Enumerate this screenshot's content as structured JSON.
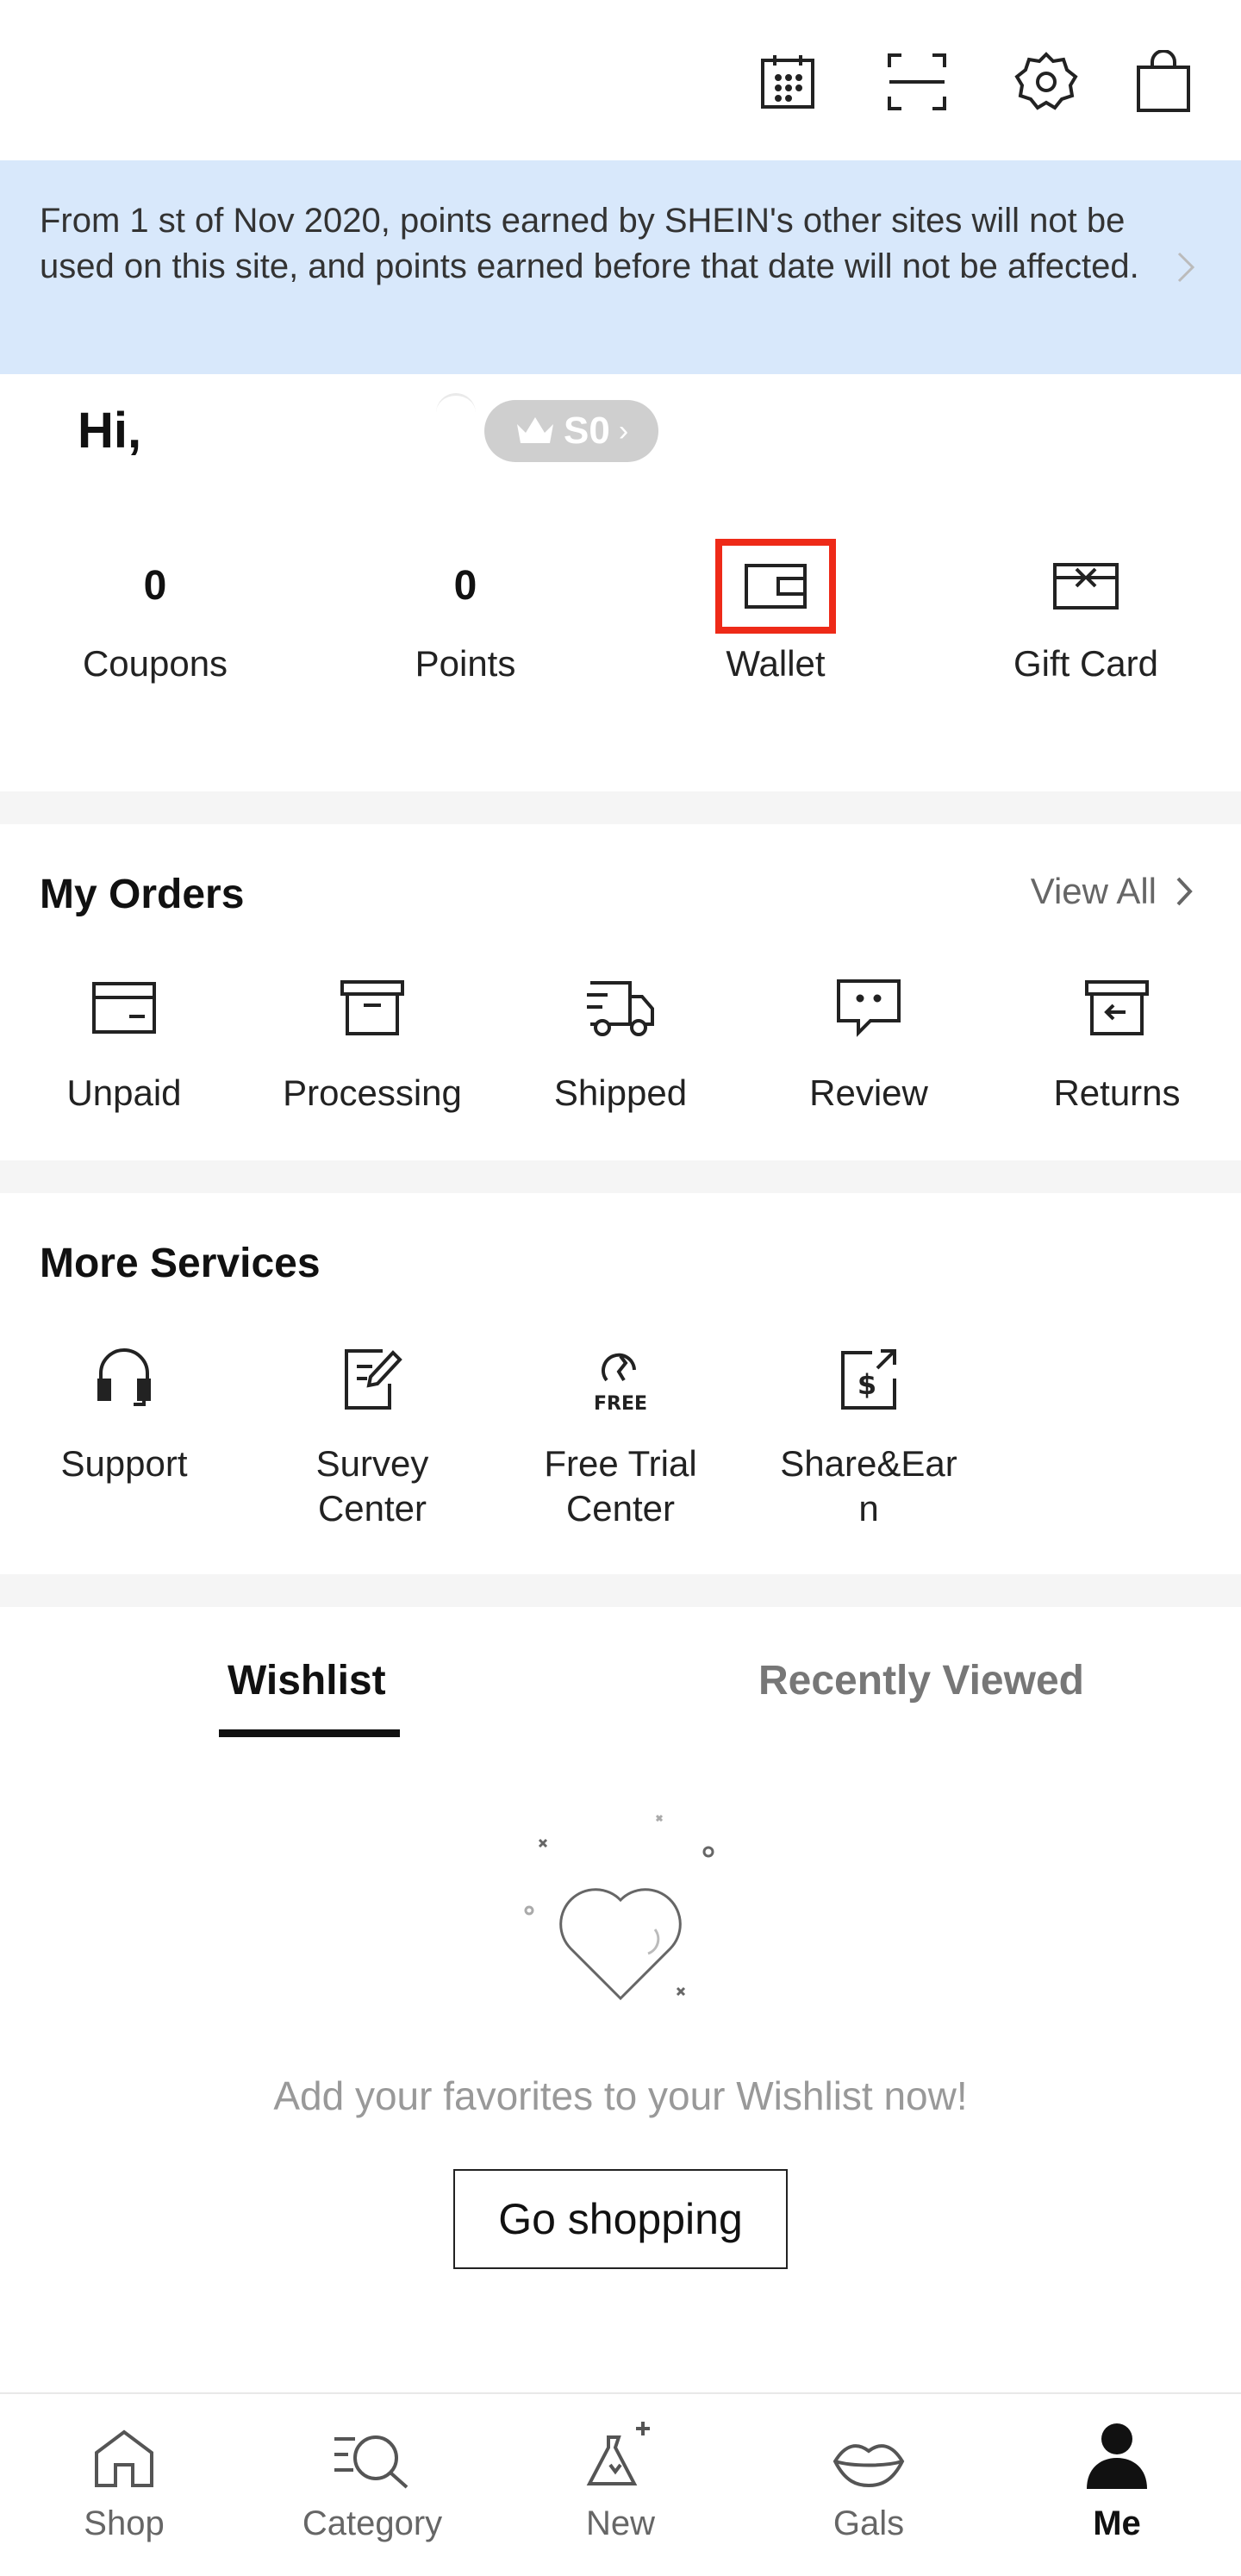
{
  "top_icons": [
    "calendar-icon",
    "scan-icon",
    "settings-icon",
    "bag-icon"
  ],
  "notice": {
    "text": "From 1 st of Nov 2020, points earned by SHEIN's other sites will not be used on this site, and points earned before that date will not be affected."
  },
  "profile": {
    "greeting": "Hi,",
    "vip_level": "S0"
  },
  "assets": [
    {
      "value": "0",
      "label": "Coupons"
    },
    {
      "value": "0",
      "label": "Points"
    },
    {
      "label": "Wallet",
      "icon": "wallet-icon"
    },
    {
      "label": "Gift Card",
      "icon": "gift-card-icon"
    }
  ],
  "orders": {
    "title": "My Orders",
    "view_all": "View All",
    "items": [
      {
        "label": "Unpaid",
        "icon": "unpaid-icon"
      },
      {
        "label": "Processing",
        "icon": "processing-icon"
      },
      {
        "label": "Shipped",
        "icon": "shipped-icon"
      },
      {
        "label": "Review",
        "icon": "review-icon"
      },
      {
        "label": "Returns",
        "icon": "returns-icon"
      }
    ]
  },
  "services": {
    "title": "More Services",
    "items": [
      {
        "line1": "Support",
        "line2": "",
        "icon": "support-icon"
      },
      {
        "line1": "Survey",
        "line2": "Center",
        "icon": "survey-icon"
      },
      {
        "line1": "Free Trial",
        "line2": "Center",
        "icon": "free-trial-icon"
      },
      {
        "line1": "Share&Ear",
        "line2": "n",
        "icon": "share-earn-icon"
      }
    ]
  },
  "tabs": {
    "wishlist": "Wishlist",
    "recently_viewed": "Recently Viewed"
  },
  "empty": {
    "text": "Add your favorites to your Wishlist now!",
    "button": "Go shopping"
  },
  "bottom_nav": [
    {
      "label": "Shop",
      "icon": "home-icon"
    },
    {
      "label": "Category",
      "icon": "category-icon"
    },
    {
      "label": "New",
      "icon": "new-icon"
    },
    {
      "label": "Gals",
      "icon": "lips-icon"
    },
    {
      "label": "Me",
      "icon": "person-icon"
    }
  ],
  "colors": {
    "notice_bg": "#d8e8fb",
    "highlight_border": "#ee2a18",
    "vip_badge": "#cfcfcf"
  }
}
